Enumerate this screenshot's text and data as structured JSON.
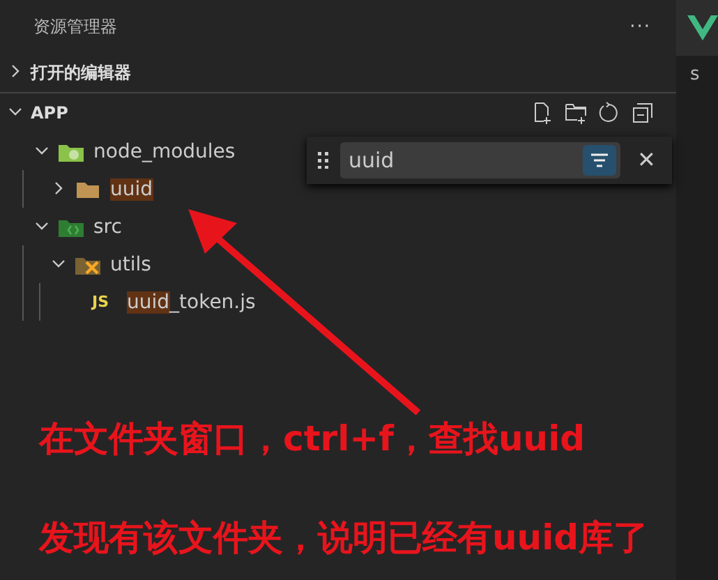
{
  "sidebar": {
    "title": "资源管理器",
    "more": "···"
  },
  "sections": [
    {
      "label": "打开的编辑器",
      "expanded": false
    },
    {
      "label": "APP",
      "expanded": true
    }
  ],
  "tree": [
    {
      "kind": "package",
      "rest": "node_modules",
      "expanded": true,
      "children": [
        {
          "kind": "plain",
          "match": "uuid",
          "expanded": false
        }
      ]
    },
    {
      "kind": "source",
      "rest": "src",
      "expanded": true,
      "children": [
        {
          "kind": "tools",
          "rest": "utils",
          "expanded": true,
          "children": [
            {
              "kind": "script",
              "icon_text": "JS",
              "match": "uuid",
              "rest": "_token.js"
            }
          ]
        }
      ]
    }
  ],
  "find_widget": {
    "value": "uuid",
    "filter_on": true,
    "close": "✕"
  },
  "editor_tab": {
    "label": "s"
  },
  "annotations": [
    "在文件夹窗口，ctrl+f，查找uuid",
    "发现有该文件夹，说明已经有uuid库了"
  ]
}
